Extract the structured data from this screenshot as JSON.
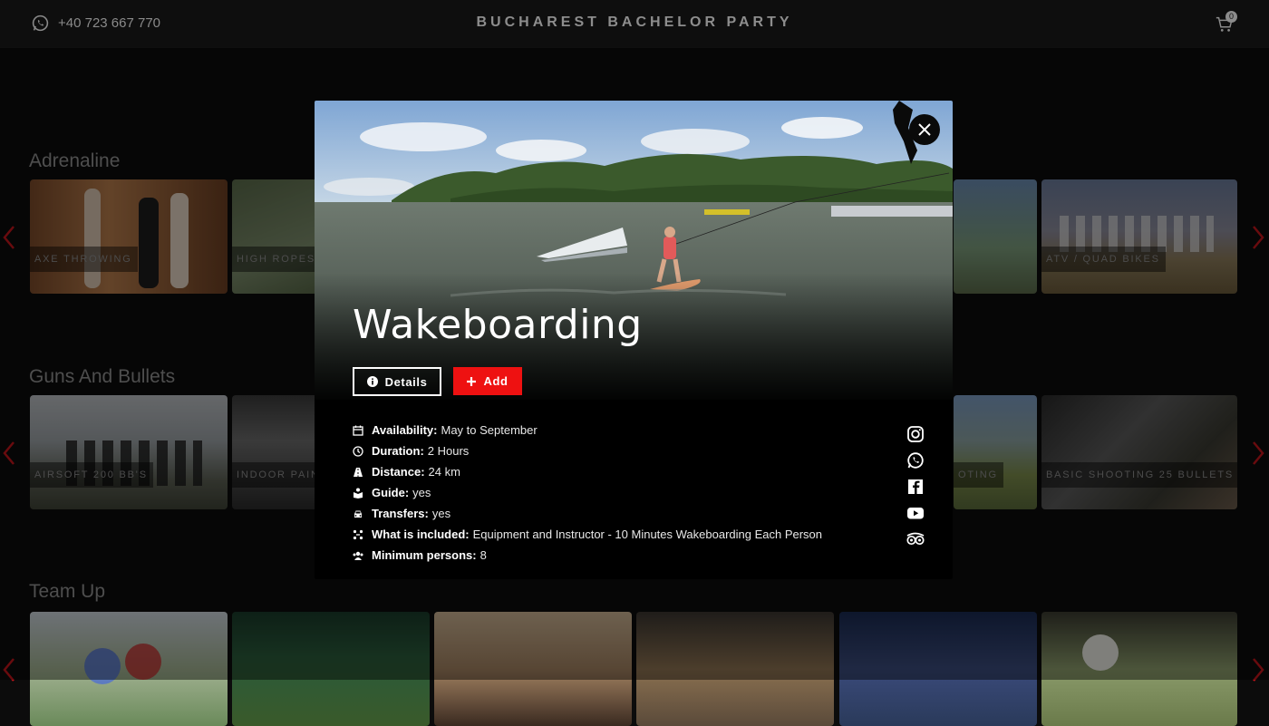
{
  "header": {
    "phone": "+40 723 667 770",
    "phone_icon": "whatsapp-icon",
    "title": "BUCHAREST BACHELOR PARTY",
    "cart_icon": "cart-icon",
    "cart_count": "0"
  },
  "sections": [
    {
      "title": "Adrenaline",
      "cards": [
        "AXE THROWING",
        "HIGH ROPES A",
        "",
        "",
        "",
        "ATV / QUAD BIKES"
      ]
    },
    {
      "title": "Guns And Bullets",
      "cards": [
        "AIRSOFT 200 BB'S",
        "INDOOR PAIN",
        "",
        "",
        "OTING",
        "BASIC SHOOTING 25 BULLETS"
      ]
    },
    {
      "title": "Team Up",
      "cards": [
        "",
        "",
        "",
        "",
        "",
        ""
      ]
    }
  ],
  "modal": {
    "title": "Wakeboarding",
    "details_label": "Details",
    "add_label": "Add",
    "close_icon": "close-icon",
    "info": [
      {
        "icon": "calendar-icon",
        "label": "Availability:",
        "value": "May to September"
      },
      {
        "icon": "clock-icon",
        "label": "Duration:",
        "value": "2 Hours"
      },
      {
        "icon": "road-icon",
        "label": "Distance:",
        "value": "24 km"
      },
      {
        "icon": "guide-icon",
        "label": "Guide:",
        "value": "yes"
      },
      {
        "icon": "car-icon",
        "label": "Transfers:",
        "value": "yes"
      },
      {
        "icon": "included-icon",
        "label": "What is included:",
        "value": "Equipment and Instructor - 10 Minutes Wakeboarding Each Person"
      },
      {
        "icon": "users-icon",
        "label": "Minimum persons:",
        "value": "8"
      }
    ],
    "socials": [
      "instagram-icon",
      "whatsapp-icon",
      "facebook-icon",
      "youtube-icon",
      "tripadvisor-icon"
    ]
  },
  "colors": {
    "accent": "#ee1111",
    "background": "#0c0c0c",
    "arrow": "#c0141a"
  }
}
